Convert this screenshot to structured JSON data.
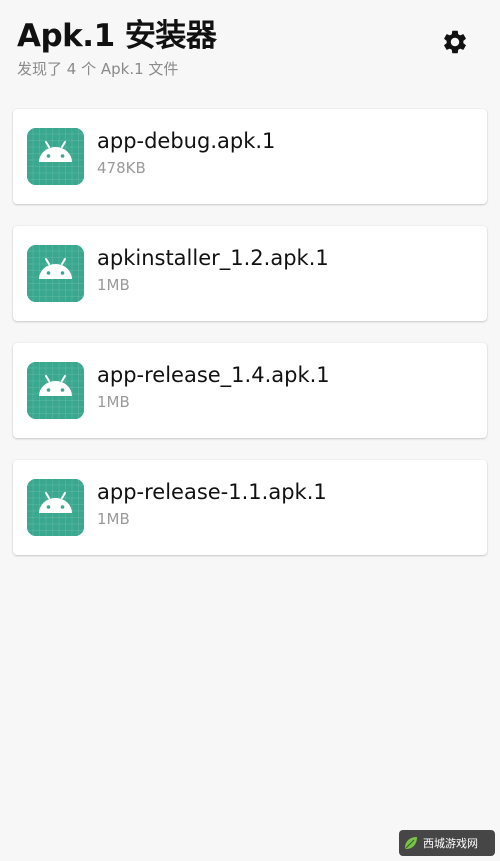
{
  "header": {
    "title": "Apk.1 安装器",
    "subtitle": "发现了 4 个 Apk.1 文件",
    "settings_icon": "gear-icon"
  },
  "files": [
    {
      "name": "app-debug.apk.1",
      "size": "478KB",
      "icon": "android-app-icon"
    },
    {
      "name": "apkinstaller_1.2.apk.1",
      "size": "1MB",
      "icon": "android-app-icon"
    },
    {
      "name": "app-release_1.4.apk.1",
      "size": "1MB",
      "icon": "android-app-icon"
    },
    {
      "name": "app-release-1.1.apk.1",
      "size": "1MB",
      "icon": "android-app-icon"
    }
  ],
  "watermark": {
    "text": "西城游戏网"
  },
  "colors": {
    "background": "#f7f7f7",
    "card": "#ffffff",
    "icon_bg": "#3aa88f",
    "title": "#111111",
    "secondary_text": "#9a9a9a"
  }
}
